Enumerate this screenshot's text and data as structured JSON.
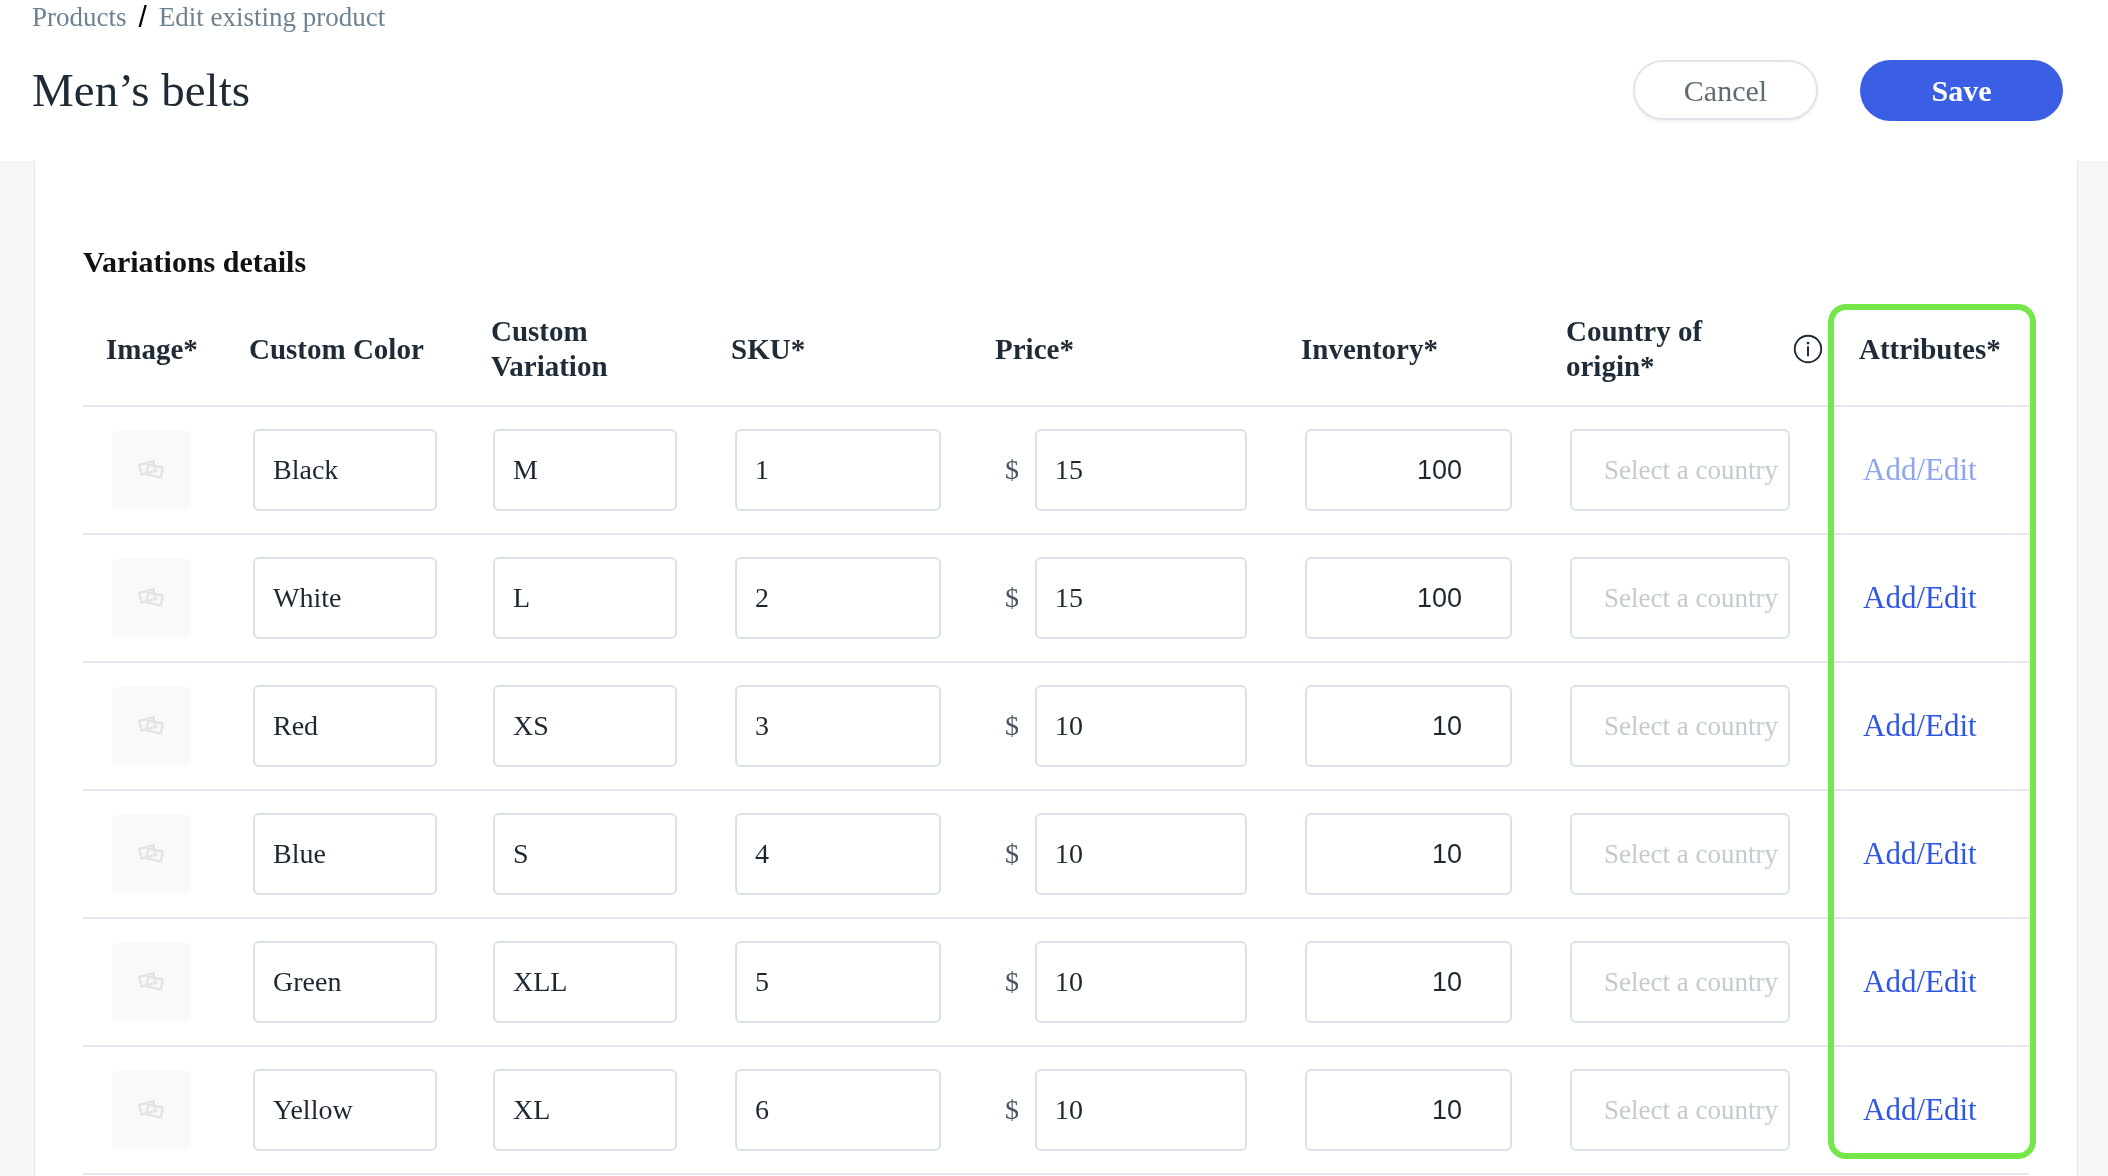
{
  "breadcrumb": {
    "items": [
      "Products",
      "Edit existing product"
    ],
    "separator": "/"
  },
  "title": "Men’s belts",
  "buttons": [
    {
      "label": "Cancel",
      "kind": "secondary"
    },
    {
      "label": "Save",
      "kind": "primary"
    }
  ],
  "variations": {
    "title": "Variations details",
    "columns": [
      {
        "label": "Image*",
        "info": false,
        "highlighted": false
      },
      {
        "label": "Custom Color",
        "info": false,
        "highlighted": false
      },
      {
        "label": "Custom Variation",
        "info": false,
        "highlighted": false
      },
      {
        "label": "SKU*",
        "info": false,
        "highlighted": false
      },
      {
        "label": "Price*",
        "info": false,
        "highlighted": false
      },
      {
        "label": "Inventory*",
        "info": false,
        "highlighted": false
      },
      {
        "label": "Country of origin*",
        "info": true,
        "highlighted": false
      },
      {
        "label": "Attributes*",
        "info": false,
        "highlighted": true
      }
    ],
    "rows": [
      {
        "custom_color": "Black",
        "custom_variation": "M",
        "sku": "1",
        "currency": "$",
        "price": "15",
        "inventory": "100",
        "country_of_origin": {
          "placeholder": "Select a country"
        },
        "attributes": {
          "label": "Add/Edit",
          "disabled": true
        }
      },
      {
        "custom_color": "White",
        "custom_variation": "L",
        "sku": "2",
        "currency": "$",
        "price": "15",
        "inventory": "100",
        "country_of_origin": {
          "placeholder": "Select a country"
        },
        "attributes": {
          "label": "Add/Edit",
          "disabled": false
        }
      },
      {
        "custom_color": "Red",
        "custom_variation": "XS",
        "sku": "3",
        "currency": "$",
        "price": "10",
        "inventory": "10",
        "country_of_origin": {
          "placeholder": "Select a country"
        },
        "attributes": {
          "label": "Add/Edit",
          "disabled": false
        }
      },
      {
        "custom_color": "Blue",
        "custom_variation": "S",
        "sku": "4",
        "currency": "$",
        "price": "10",
        "inventory": "10",
        "country_of_origin": {
          "placeholder": "Select a country"
        },
        "attributes": {
          "label": "Add/Edit",
          "disabled": false
        }
      },
      {
        "custom_color": "Green",
        "custom_variation": "XLL",
        "sku": "5",
        "currency": "$",
        "price": "10",
        "inventory": "10",
        "country_of_origin": {
          "placeholder": "Select a country"
        },
        "attributes": {
          "label": "Add/Edit",
          "disabled": false
        }
      },
      {
        "custom_color": "Yellow",
        "custom_variation": "XL",
        "sku": "6",
        "currency": "$",
        "price": "10",
        "inventory": "10",
        "country_of_origin": {
          "placeholder": "Select a country"
        },
        "attributes": {
          "label": "Add/Edit",
          "disabled": false
        }
      }
    ]
  }
}
